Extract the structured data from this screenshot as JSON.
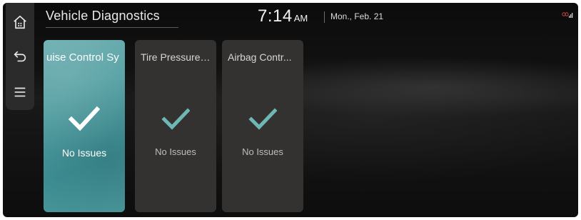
{
  "header": {
    "title": "Vehicle Diagnostics",
    "time": "7:14",
    "ampm": "AM",
    "date": "Mon., Feb. 21"
  },
  "rail": {
    "items": [
      {
        "icon": "home-icon"
      },
      {
        "icon": "back-icon"
      },
      {
        "icon": "menu-icon"
      }
    ]
  },
  "cards": [
    {
      "title": "uise Control Sy",
      "status": "No Issues",
      "selected": true
    },
    {
      "title": "Tire Pressure ...",
      "status": "No Issues",
      "selected": false
    },
    {
      "title": "Airbag Contr...",
      "status": "No Issues",
      "selected": false
    }
  ],
  "colors": {
    "accent": "#4f9ca0",
    "check_normal": "#6fb7b5",
    "check_selected": "#ffffff",
    "card": "#333231"
  },
  "status_icons": [
    "signal-icon"
  ]
}
